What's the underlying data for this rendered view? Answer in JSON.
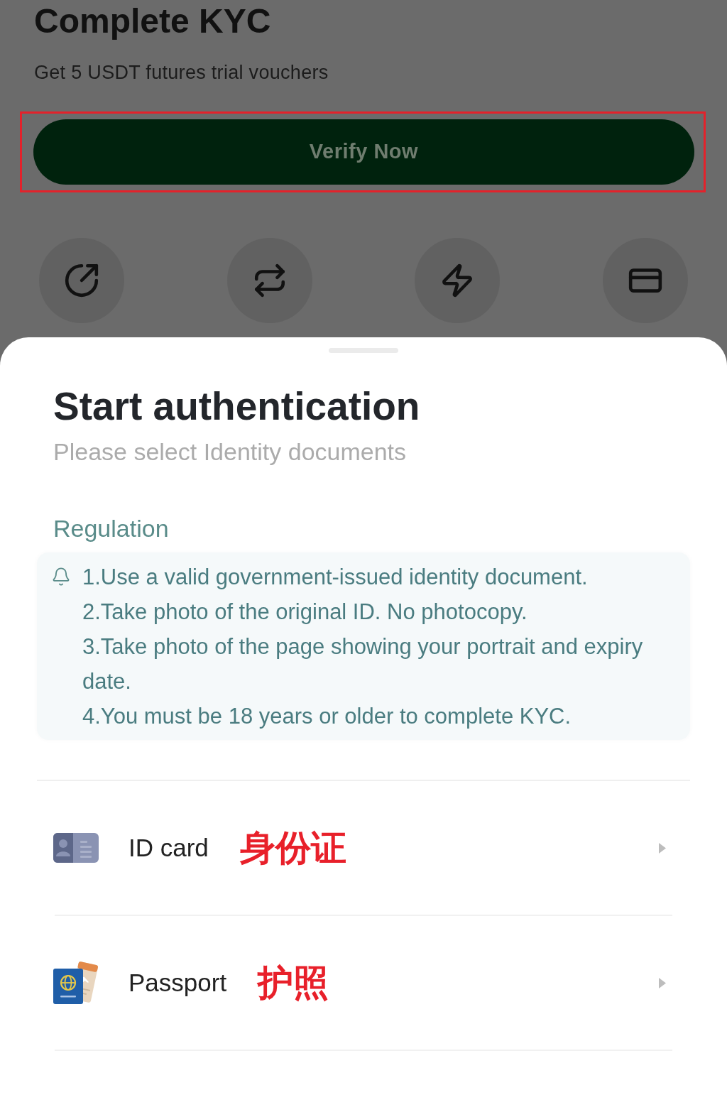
{
  "background": {
    "title": "Complete KYC",
    "subtitle": "Get 5 USDT futures trial vouchers",
    "primary_button": {
      "label": "Verify Now",
      "highlighted": true
    }
  },
  "sheet": {
    "title": "Start authentication",
    "subtitle": "Please select Identity documents",
    "regulation": {
      "heading": "Regulation",
      "rules": [
        "1.Use a valid government-issued identity document.",
        "2.Take photo of the original ID. No photocopy.",
        "3.Take photo of the page showing your portrait and expiry date.",
        "4.You must be 18 years or older to complete KYC."
      ]
    },
    "documents": [
      {
        "kind": "id_card",
        "label": "ID card",
        "annotation": "身份证"
      },
      {
        "kind": "passport",
        "label": "Passport",
        "annotation": "护照"
      }
    ]
  }
}
